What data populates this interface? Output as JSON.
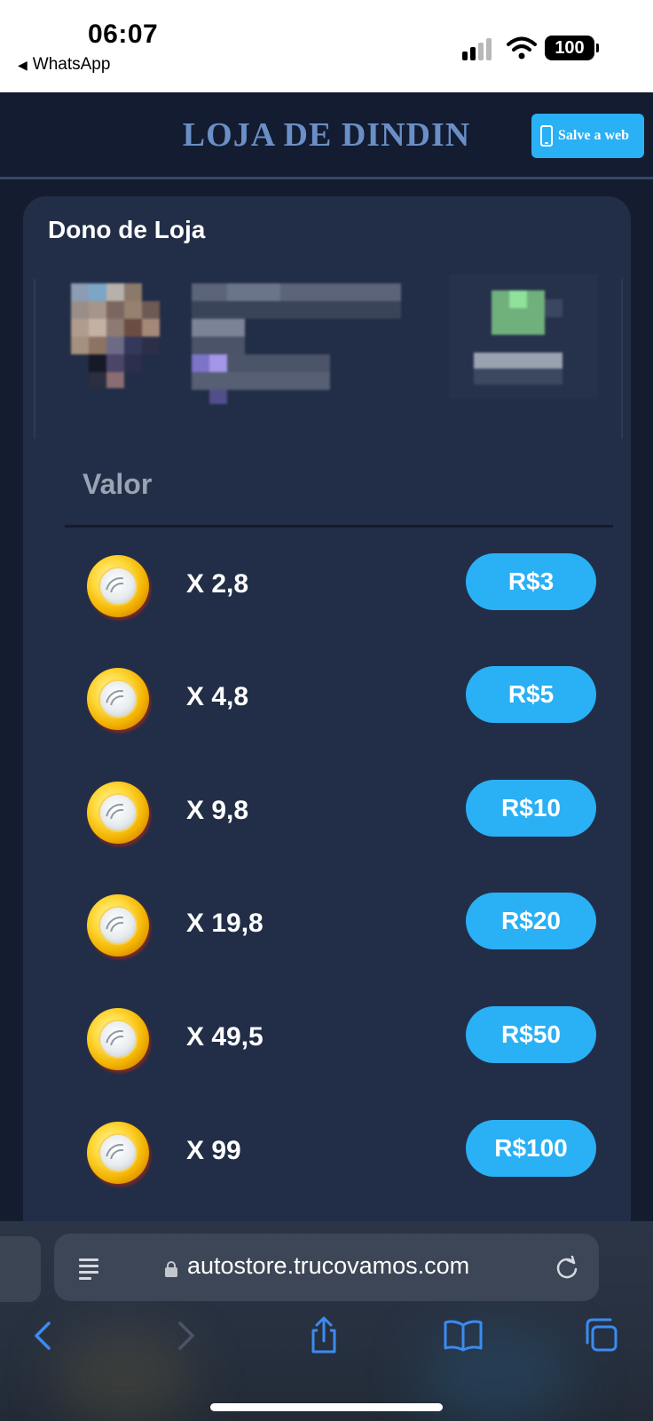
{
  "status_bar": {
    "time": "06:07",
    "back_app": "WhatsApp",
    "battery": "100",
    "icons": [
      "signal-icon",
      "wifi-icon",
      "battery-icon"
    ]
  },
  "header": {
    "brand": "LOJA DE DINDIN",
    "save_button": "Salve a web",
    "save_icon": "phone-icon"
  },
  "card": {
    "title": "Dono de Loja",
    "value_label": "Valor",
    "offers": [
      {
        "multiplier": "X 2,8",
        "price": "R$3"
      },
      {
        "multiplier": "X 4,8",
        "price": "R$5"
      },
      {
        "multiplier": "X 9,8",
        "price": "R$10"
      },
      {
        "multiplier": "X 19,8",
        "price": "R$20"
      },
      {
        "multiplier": "X 49,5",
        "price": "R$50"
      },
      {
        "multiplier": "X 99",
        "price": "R$100"
      }
    ]
  },
  "browser": {
    "url": "autostore.trucovamos.com",
    "toolbar": [
      "back-icon",
      "forward-icon",
      "share-icon",
      "bookmarks-icon",
      "tabs-icon"
    ]
  },
  "colors": {
    "accent": "#2ab0f5",
    "card_bg": "#222e47",
    "page_bg": "#141c2f",
    "brand_text": "#6a8fc6"
  }
}
